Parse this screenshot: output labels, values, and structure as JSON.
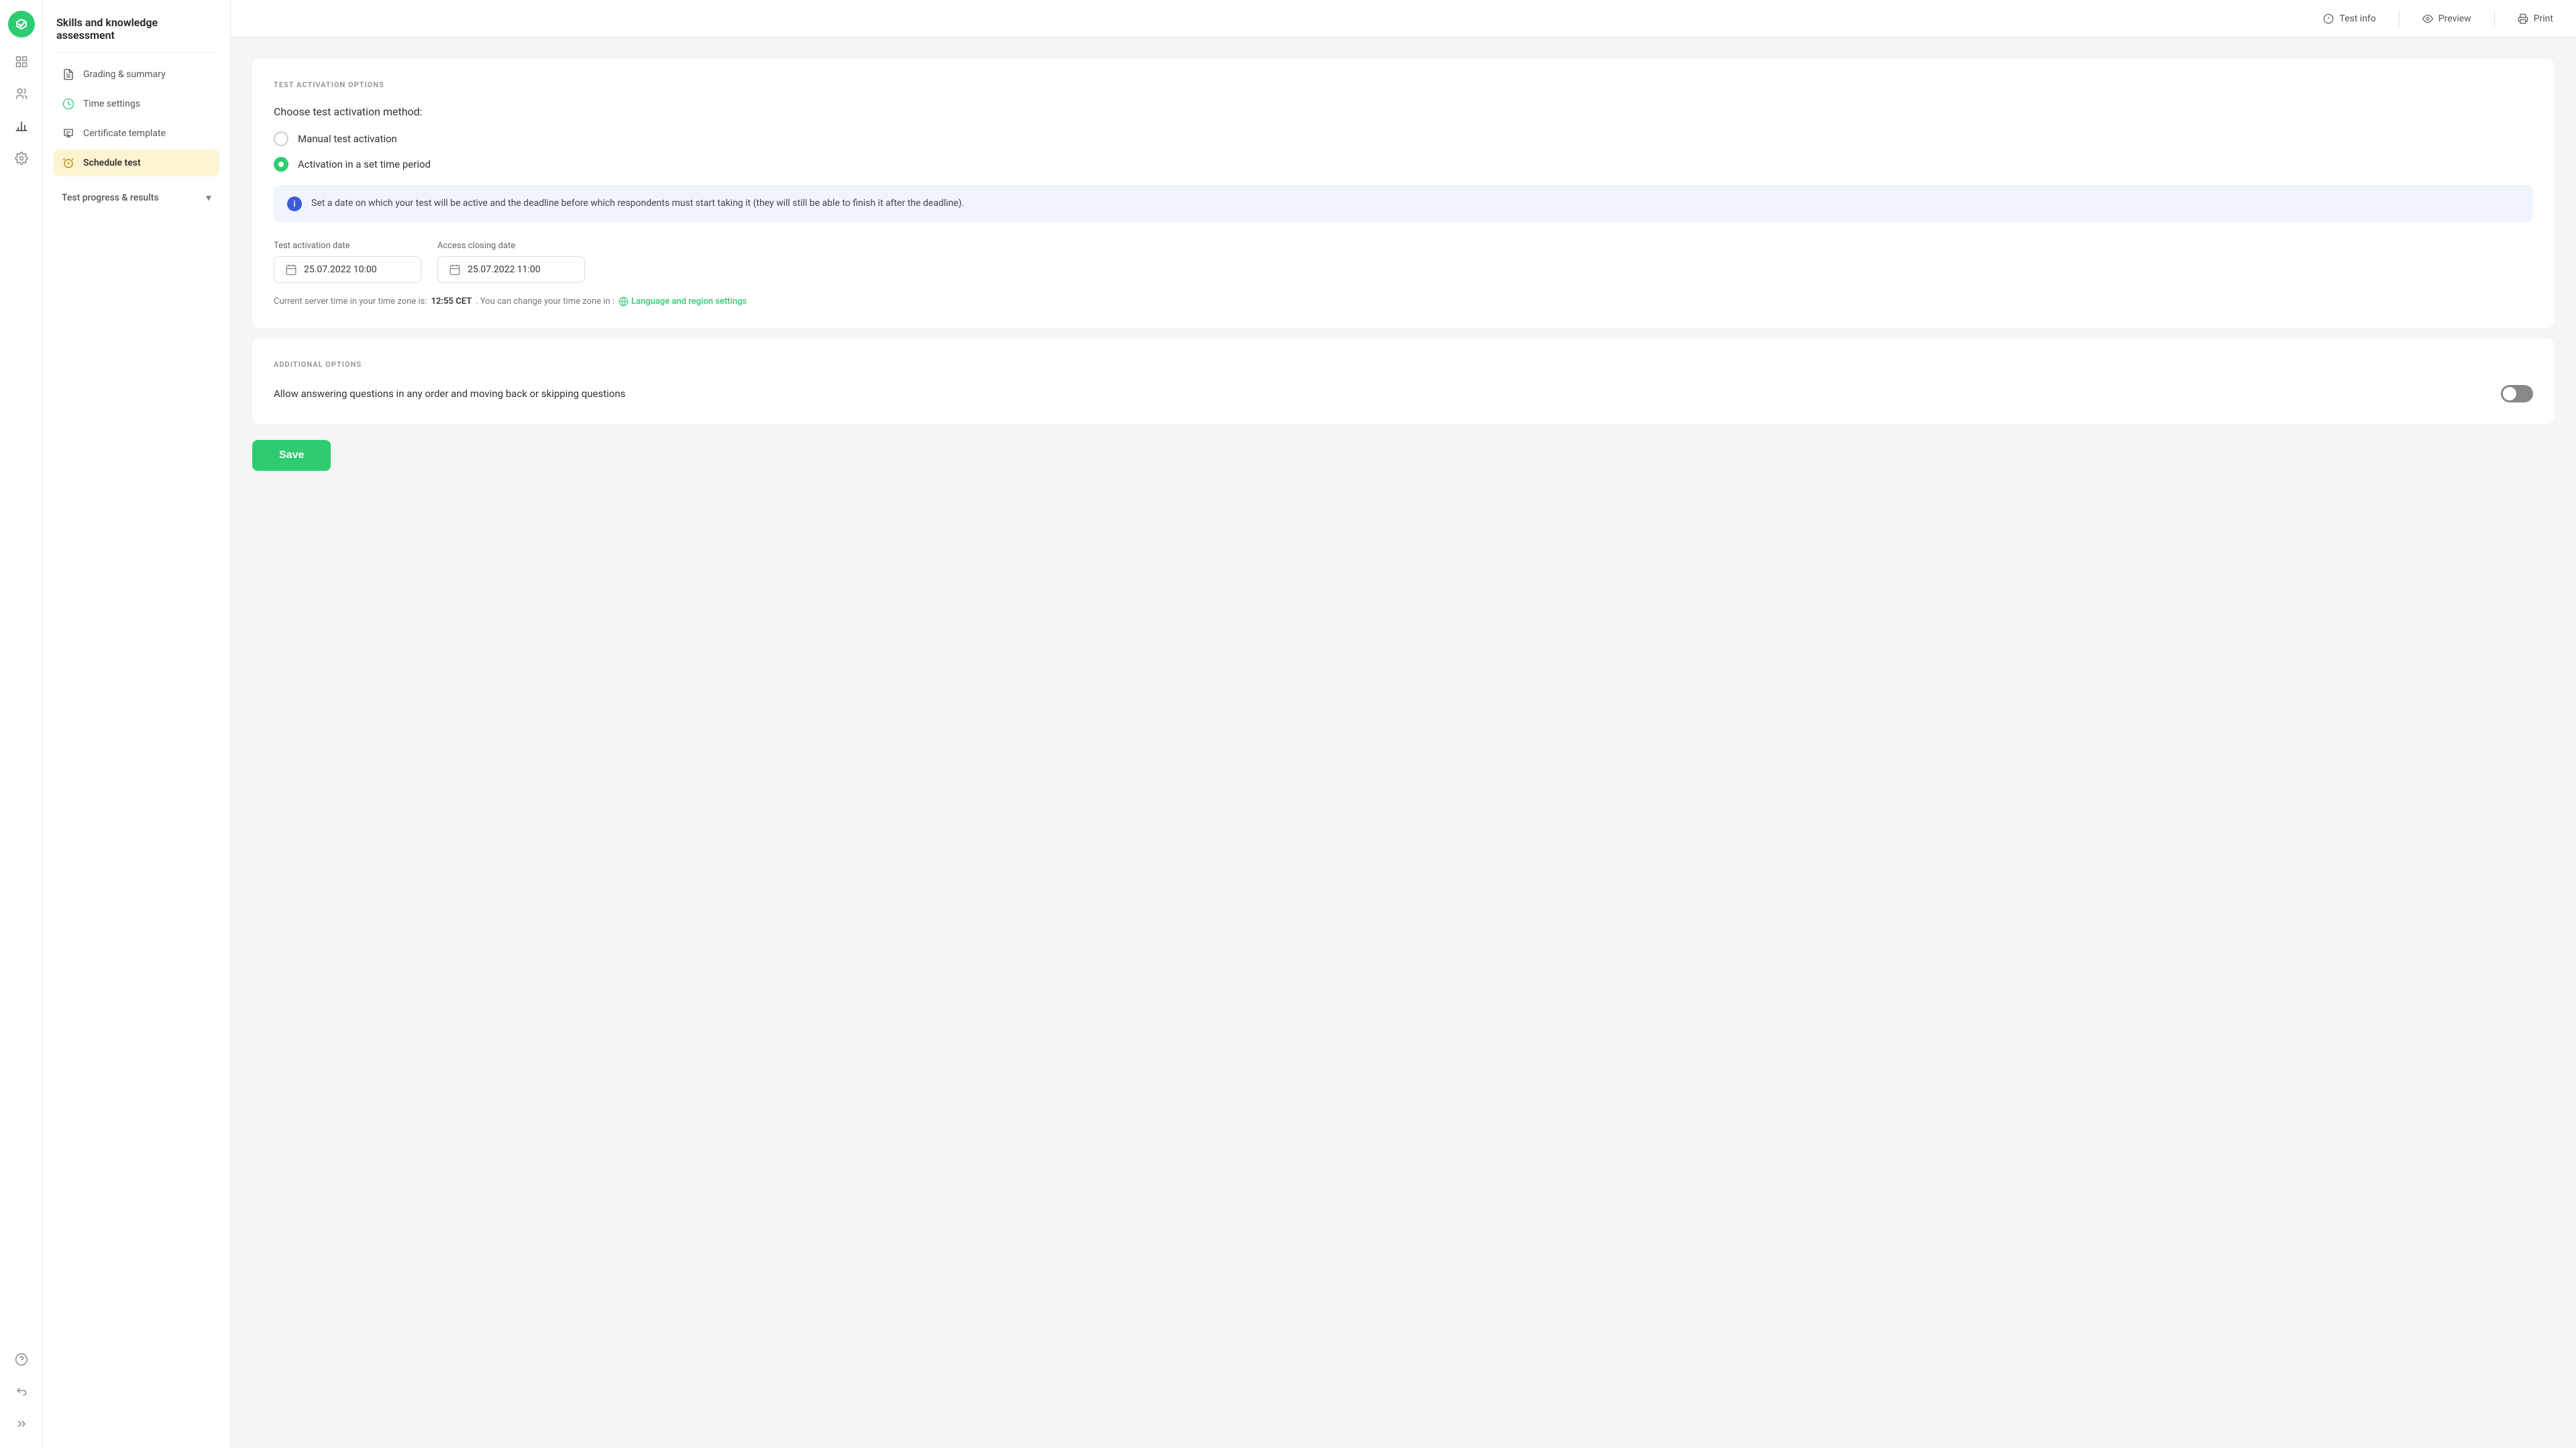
{
  "app": {
    "title": "Skills and knowledge assessment"
  },
  "topbar": {
    "test_info_label": "Test info",
    "preview_label": "Preview",
    "print_label": "Print"
  },
  "sidebar": {
    "items": [
      {
        "id": "grading",
        "label": "Grading & summary",
        "icon": "doc-icon",
        "active": false
      },
      {
        "id": "time-settings",
        "label": "Time settings",
        "icon": "clock-icon",
        "active": false
      },
      {
        "id": "certificate",
        "label": "Certificate template",
        "icon": "cert-icon",
        "active": false
      },
      {
        "id": "schedule",
        "label": "Schedule test",
        "icon": "alarm-icon",
        "active": true
      }
    ],
    "sections": [
      {
        "id": "test-progress",
        "label": "Test progress & results"
      }
    ]
  },
  "content": {
    "activation_section_label": "TEST ACTIVATION OPTIONS",
    "choose_label": "Choose test activation method:",
    "radio_options": [
      {
        "id": "manual",
        "label": "Manual test activation",
        "checked": false
      },
      {
        "id": "set-time",
        "label": "Activation in a set time period",
        "checked": true
      }
    ],
    "info_text": "Set a date on which your test will be active and the deadline before which respondents must start taking it (they will still be able to finish it after the deadline).",
    "activation_date_label": "Test activation date",
    "activation_date_value": "25.07.2022 10:00",
    "closing_date_label": "Access closing date",
    "closing_date_value": "25.07.2022 11:00",
    "server_time_prefix": "Current server time in your time zone is:",
    "server_time_value": "12:55 CET",
    "server_time_suffix": ". You can change your time zone in :",
    "settings_link_label": "Language and region settings",
    "additional_section_label": "ADDITIONAL OPTIONS",
    "toggle_label": "Allow answering questions in any order and moving back or skipping questions",
    "toggle_on": false,
    "save_label": "Save"
  }
}
